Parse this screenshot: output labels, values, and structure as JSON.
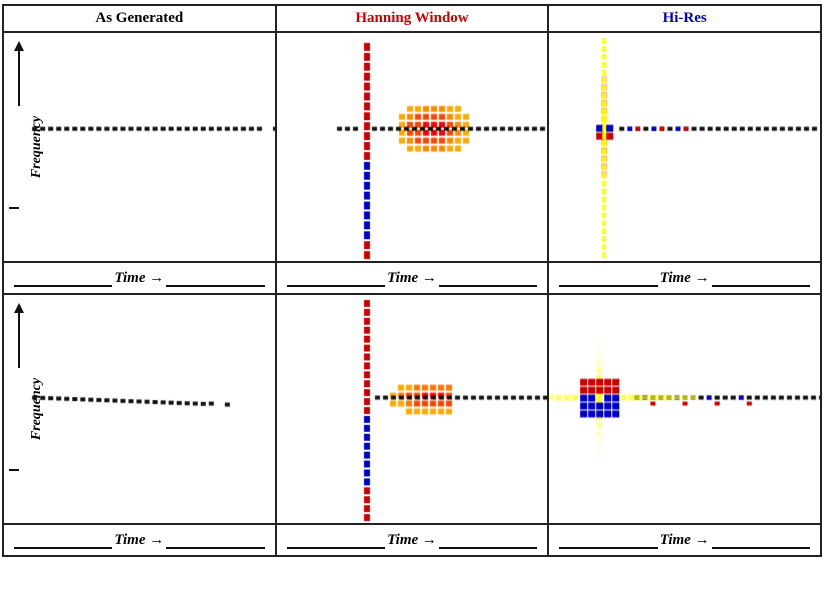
{
  "headers": [
    {
      "label": "As Generated",
      "color": "black"
    },
    {
      "label": "Hanning Window",
      "color": "red"
    },
    {
      "label": "Hi-Res",
      "color": "blue"
    }
  ],
  "time_labels": [
    "Time",
    "Time",
    "Time"
  ],
  "freq_label": "Frequency",
  "rows": [
    {
      "type": "top"
    },
    {
      "type": "bottom"
    }
  ]
}
